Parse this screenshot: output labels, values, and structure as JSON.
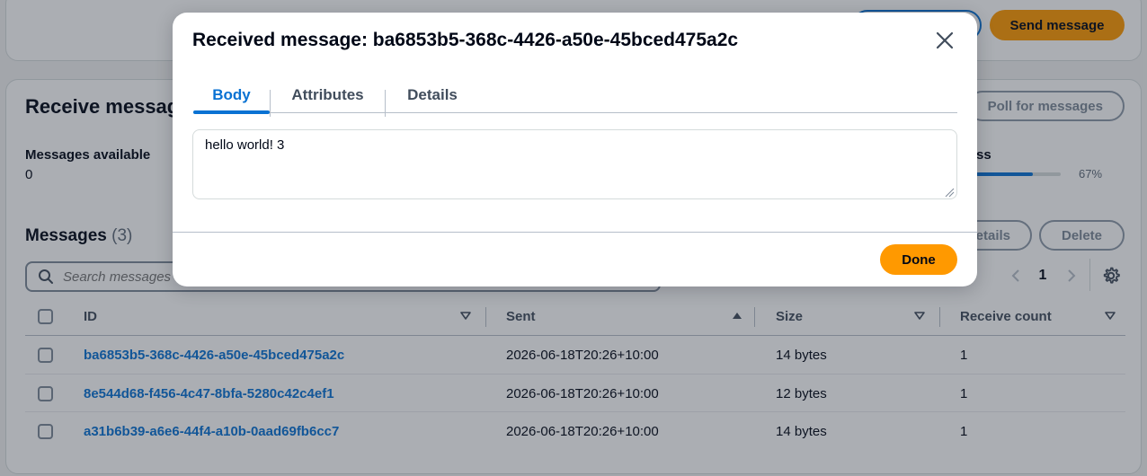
{
  "header": {
    "outline_button_label": "",
    "send_button_label": "Send message"
  },
  "receive": {
    "title": "Receive message",
    "poll_button_label": "Poll for messages",
    "available_label": "Messages available",
    "available_value": "0",
    "progress_label": "ss",
    "progress_fraction": 0.67,
    "progress_pct": "67%"
  },
  "messages": {
    "title": "Messages",
    "count": "(3)",
    "details_button_label": "etails",
    "delete_button_label": "Delete",
    "search_placeholder": "Search messages",
    "page_number": "1",
    "columns": {
      "id": "ID",
      "sent": "Sent",
      "size": "Size",
      "receive_count": "Receive count"
    },
    "rows": [
      {
        "id": "ba6853b5-368c-4426-a50e-45bced475a2c",
        "sent": "2026-06-18T20:26+10:00",
        "size": "14 bytes",
        "receive_count": "1"
      },
      {
        "id": "8e544d68-f456-4c47-8bfa-5280c42c4ef1",
        "sent": "2026-06-18T20:26+10:00",
        "size": "12 bytes",
        "receive_count": "1"
      },
      {
        "id": "a31b6b39-a6e6-44f4-a10b-0aad69fb6cc7",
        "sent": "2026-06-18T20:26+10:00",
        "size": "14 bytes",
        "receive_count": "1"
      }
    ]
  },
  "modal": {
    "title": "Received message: ba6853b5-368c-4426-a50e-45bced475a2c",
    "tabs": [
      {
        "label": "Body",
        "active": true
      },
      {
        "label": "Attributes",
        "active": false
      },
      {
        "label": "Details",
        "active": false
      }
    ],
    "body_text": "hello world! 3",
    "done_label": "Done"
  },
  "colors": {
    "accent": "#0972d3",
    "primary": "#ff9900"
  },
  "icons": [
    "search-icon",
    "gear-icon",
    "close-icon",
    "sort-down-icon",
    "sort-up-icon",
    "chevron-left-icon",
    "chevron-right-icon"
  ]
}
